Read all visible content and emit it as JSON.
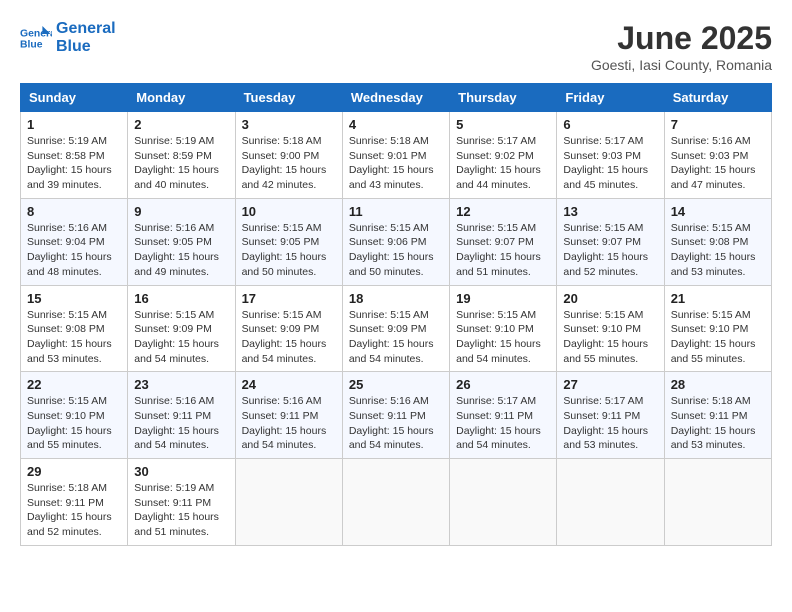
{
  "logo": {
    "line1": "General",
    "line2": "Blue"
  },
  "title": "June 2025",
  "location": "Goesti, Iasi County, Romania",
  "days_of_week": [
    "Sunday",
    "Monday",
    "Tuesday",
    "Wednesday",
    "Thursday",
    "Friday",
    "Saturday"
  ],
  "weeks": [
    [
      {
        "day": "1",
        "sunrise": "Sunrise: 5:19 AM",
        "sunset": "Sunset: 8:58 PM",
        "daylight": "Daylight: 15 hours and 39 minutes."
      },
      {
        "day": "2",
        "sunrise": "Sunrise: 5:19 AM",
        "sunset": "Sunset: 8:59 PM",
        "daylight": "Daylight: 15 hours and 40 minutes."
      },
      {
        "day": "3",
        "sunrise": "Sunrise: 5:18 AM",
        "sunset": "Sunset: 9:00 PM",
        "daylight": "Daylight: 15 hours and 42 minutes."
      },
      {
        "day": "4",
        "sunrise": "Sunrise: 5:18 AM",
        "sunset": "Sunset: 9:01 PM",
        "daylight": "Daylight: 15 hours and 43 minutes."
      },
      {
        "day": "5",
        "sunrise": "Sunrise: 5:17 AM",
        "sunset": "Sunset: 9:02 PM",
        "daylight": "Daylight: 15 hours and 44 minutes."
      },
      {
        "day": "6",
        "sunrise": "Sunrise: 5:17 AM",
        "sunset": "Sunset: 9:03 PM",
        "daylight": "Daylight: 15 hours and 45 minutes."
      },
      {
        "day": "7",
        "sunrise": "Sunrise: 5:16 AM",
        "sunset": "Sunset: 9:03 PM",
        "daylight": "Daylight: 15 hours and 47 minutes."
      }
    ],
    [
      {
        "day": "8",
        "sunrise": "Sunrise: 5:16 AM",
        "sunset": "Sunset: 9:04 PM",
        "daylight": "Daylight: 15 hours and 48 minutes."
      },
      {
        "day": "9",
        "sunrise": "Sunrise: 5:16 AM",
        "sunset": "Sunset: 9:05 PM",
        "daylight": "Daylight: 15 hours and 49 minutes."
      },
      {
        "day": "10",
        "sunrise": "Sunrise: 5:15 AM",
        "sunset": "Sunset: 9:05 PM",
        "daylight": "Daylight: 15 hours and 50 minutes."
      },
      {
        "day": "11",
        "sunrise": "Sunrise: 5:15 AM",
        "sunset": "Sunset: 9:06 PM",
        "daylight": "Daylight: 15 hours and 50 minutes."
      },
      {
        "day": "12",
        "sunrise": "Sunrise: 5:15 AM",
        "sunset": "Sunset: 9:07 PM",
        "daylight": "Daylight: 15 hours and 51 minutes."
      },
      {
        "day": "13",
        "sunrise": "Sunrise: 5:15 AM",
        "sunset": "Sunset: 9:07 PM",
        "daylight": "Daylight: 15 hours and 52 minutes."
      },
      {
        "day": "14",
        "sunrise": "Sunrise: 5:15 AM",
        "sunset": "Sunset: 9:08 PM",
        "daylight": "Daylight: 15 hours and 53 minutes."
      }
    ],
    [
      {
        "day": "15",
        "sunrise": "Sunrise: 5:15 AM",
        "sunset": "Sunset: 9:08 PM",
        "daylight": "Daylight: 15 hours and 53 minutes."
      },
      {
        "day": "16",
        "sunrise": "Sunrise: 5:15 AM",
        "sunset": "Sunset: 9:09 PM",
        "daylight": "Daylight: 15 hours and 54 minutes."
      },
      {
        "day": "17",
        "sunrise": "Sunrise: 5:15 AM",
        "sunset": "Sunset: 9:09 PM",
        "daylight": "Daylight: 15 hours and 54 minutes."
      },
      {
        "day": "18",
        "sunrise": "Sunrise: 5:15 AM",
        "sunset": "Sunset: 9:09 PM",
        "daylight": "Daylight: 15 hours and 54 minutes."
      },
      {
        "day": "19",
        "sunrise": "Sunrise: 5:15 AM",
        "sunset": "Sunset: 9:10 PM",
        "daylight": "Daylight: 15 hours and 54 minutes."
      },
      {
        "day": "20",
        "sunrise": "Sunrise: 5:15 AM",
        "sunset": "Sunset: 9:10 PM",
        "daylight": "Daylight: 15 hours and 55 minutes."
      },
      {
        "day": "21",
        "sunrise": "Sunrise: 5:15 AM",
        "sunset": "Sunset: 9:10 PM",
        "daylight": "Daylight: 15 hours and 55 minutes."
      }
    ],
    [
      {
        "day": "22",
        "sunrise": "Sunrise: 5:15 AM",
        "sunset": "Sunset: 9:10 PM",
        "daylight": "Daylight: 15 hours and 55 minutes."
      },
      {
        "day": "23",
        "sunrise": "Sunrise: 5:16 AM",
        "sunset": "Sunset: 9:11 PM",
        "daylight": "Daylight: 15 hours and 54 minutes."
      },
      {
        "day": "24",
        "sunrise": "Sunrise: 5:16 AM",
        "sunset": "Sunset: 9:11 PM",
        "daylight": "Daylight: 15 hours and 54 minutes."
      },
      {
        "day": "25",
        "sunrise": "Sunrise: 5:16 AM",
        "sunset": "Sunset: 9:11 PM",
        "daylight": "Daylight: 15 hours and 54 minutes."
      },
      {
        "day": "26",
        "sunrise": "Sunrise: 5:17 AM",
        "sunset": "Sunset: 9:11 PM",
        "daylight": "Daylight: 15 hours and 54 minutes."
      },
      {
        "day": "27",
        "sunrise": "Sunrise: 5:17 AM",
        "sunset": "Sunset: 9:11 PM",
        "daylight": "Daylight: 15 hours and 53 minutes."
      },
      {
        "day": "28",
        "sunrise": "Sunrise: 5:18 AM",
        "sunset": "Sunset: 9:11 PM",
        "daylight": "Daylight: 15 hours and 53 minutes."
      }
    ],
    [
      {
        "day": "29",
        "sunrise": "Sunrise: 5:18 AM",
        "sunset": "Sunset: 9:11 PM",
        "daylight": "Daylight: 15 hours and 52 minutes."
      },
      {
        "day": "30",
        "sunrise": "Sunrise: 5:19 AM",
        "sunset": "Sunset: 9:11 PM",
        "daylight": "Daylight: 15 hours and 51 minutes."
      },
      null,
      null,
      null,
      null,
      null
    ]
  ]
}
